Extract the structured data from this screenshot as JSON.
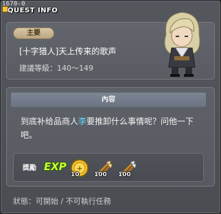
{
  "window": {
    "quest_id": "1670-0",
    "title": "QUEST INFO"
  },
  "header": {
    "quest_type": "主要",
    "quest_name": "[十字猎人]天上传来的歌声",
    "level_text": "建議等級：140～149"
  },
  "content": {
    "section_title": "內容",
    "text_before": "到底补给品商人",
    "text_highlight": "李",
    "text_after": "要推卸什么事情呢？问他一下吧。"
  },
  "rewards": {
    "label": "獎勵",
    "exp_label": "EXP",
    "items": [
      {
        "icon": "gold-coin-icon",
        "count": "10"
      },
      {
        "icon": "fire-arrow-icon",
        "count": "100"
      },
      {
        "icon": "ice-arrow-icon",
        "count": "100"
      }
    ]
  },
  "status": {
    "text": "狀態：可開始 / 不可執行任務"
  },
  "colors": {
    "highlight": "#5fd9ff",
    "badge": "#c8b38e",
    "exp": "#c9ff3b"
  }
}
